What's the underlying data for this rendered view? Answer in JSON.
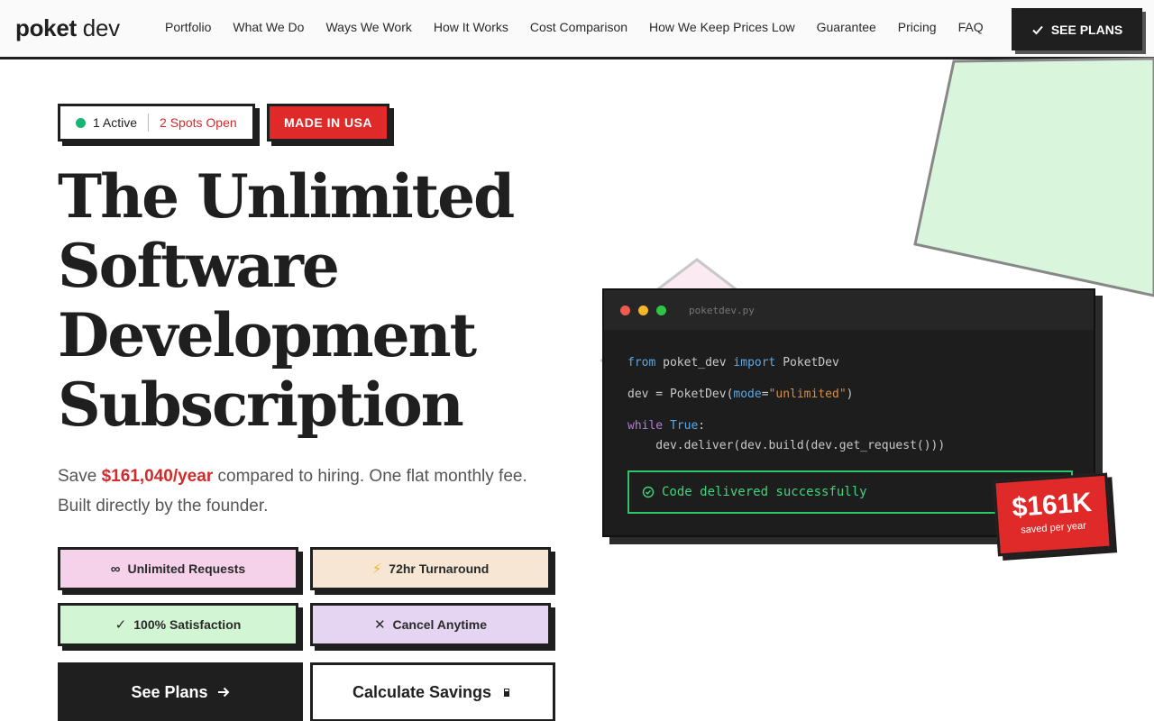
{
  "nav": {
    "logo_bold": "poket",
    "logo_light": "dev",
    "links": [
      "Portfolio",
      "What We Do",
      "Ways We Work",
      "How It Works",
      "Cost Comparison",
      "How We Keep Prices Low",
      "Guarantee",
      "Pricing",
      "FAQ"
    ],
    "cta_label": "SEE PLANS"
  },
  "badges": {
    "active": "1 Active",
    "spots_open": "2 Spots Open",
    "made_in": "MADE IN USA"
  },
  "hero": {
    "line1_prefix": "The",
    "line1_highlight": "Unlimited",
    "line2": "Software",
    "line3": "Development",
    "line4": "Subscription",
    "sub_prefix": "Save",
    "sub_amount": "$161,040/year",
    "sub_suffix": "compared to hiring. One flat monthly fee. Built directly by the founder."
  },
  "features": [
    {
      "icon": "∞",
      "label": "Unlimited Requests"
    },
    {
      "icon": "⚡",
      "label": "72hr Turnaround"
    },
    {
      "icon": "✓",
      "label": "100% Satisfaction"
    },
    {
      "icon": "✕",
      "label": "Cancel Anytime"
    }
  ],
  "buttons": {
    "primary": "See Plans",
    "secondary": "Calculate Savings"
  },
  "code": {
    "filename": "poketdev.py",
    "success": "Code delivered successfully"
  },
  "savings_badge": {
    "amount": "$161K",
    "label": "saved per year"
  },
  "colors": {
    "accent_red": "#e02a2a",
    "dark": "#1f1f1f",
    "green": "#18b574"
  }
}
